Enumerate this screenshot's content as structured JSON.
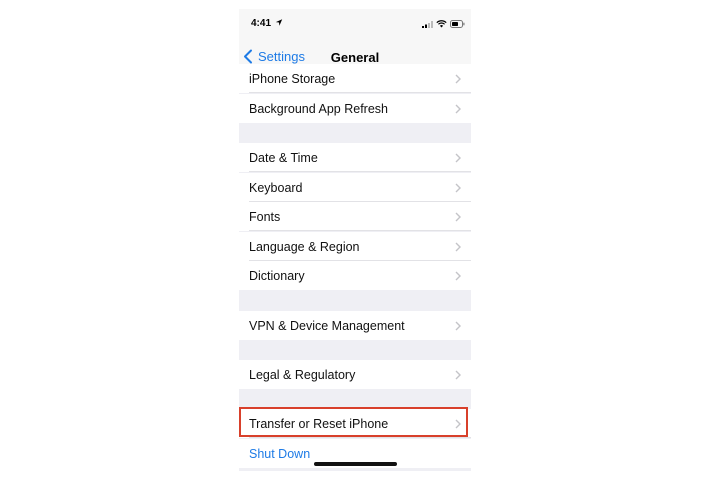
{
  "status_bar": {
    "time": "4:41"
  },
  "nav": {
    "back_label": "Settings",
    "title": "General"
  },
  "groups": {
    "storage": [
      {
        "label": "iPhone Storage"
      },
      {
        "label": "Background App Refresh"
      }
    ],
    "locale": [
      {
        "label": "Date & Time"
      },
      {
        "label": "Keyboard"
      },
      {
        "label": "Fonts"
      },
      {
        "label": "Language & Region"
      },
      {
        "label": "Dictionary"
      }
    ],
    "vpn": [
      {
        "label": "VPN & Device Management"
      }
    ],
    "legal": [
      {
        "label": "Legal & Regulatory"
      }
    ],
    "reset": [
      {
        "label": "Transfer or Reset iPhone"
      }
    ],
    "shutdown": {
      "label": "Shut Down"
    }
  },
  "colors": {
    "accent": "#1e7be6",
    "highlight_border": "#d8402b",
    "group_background": "#efeff4"
  },
  "icons": [
    "location-arrow-icon",
    "signal-icon",
    "wifi-icon",
    "battery-icon",
    "chevron-left-icon",
    "chevron-right-icon"
  ]
}
